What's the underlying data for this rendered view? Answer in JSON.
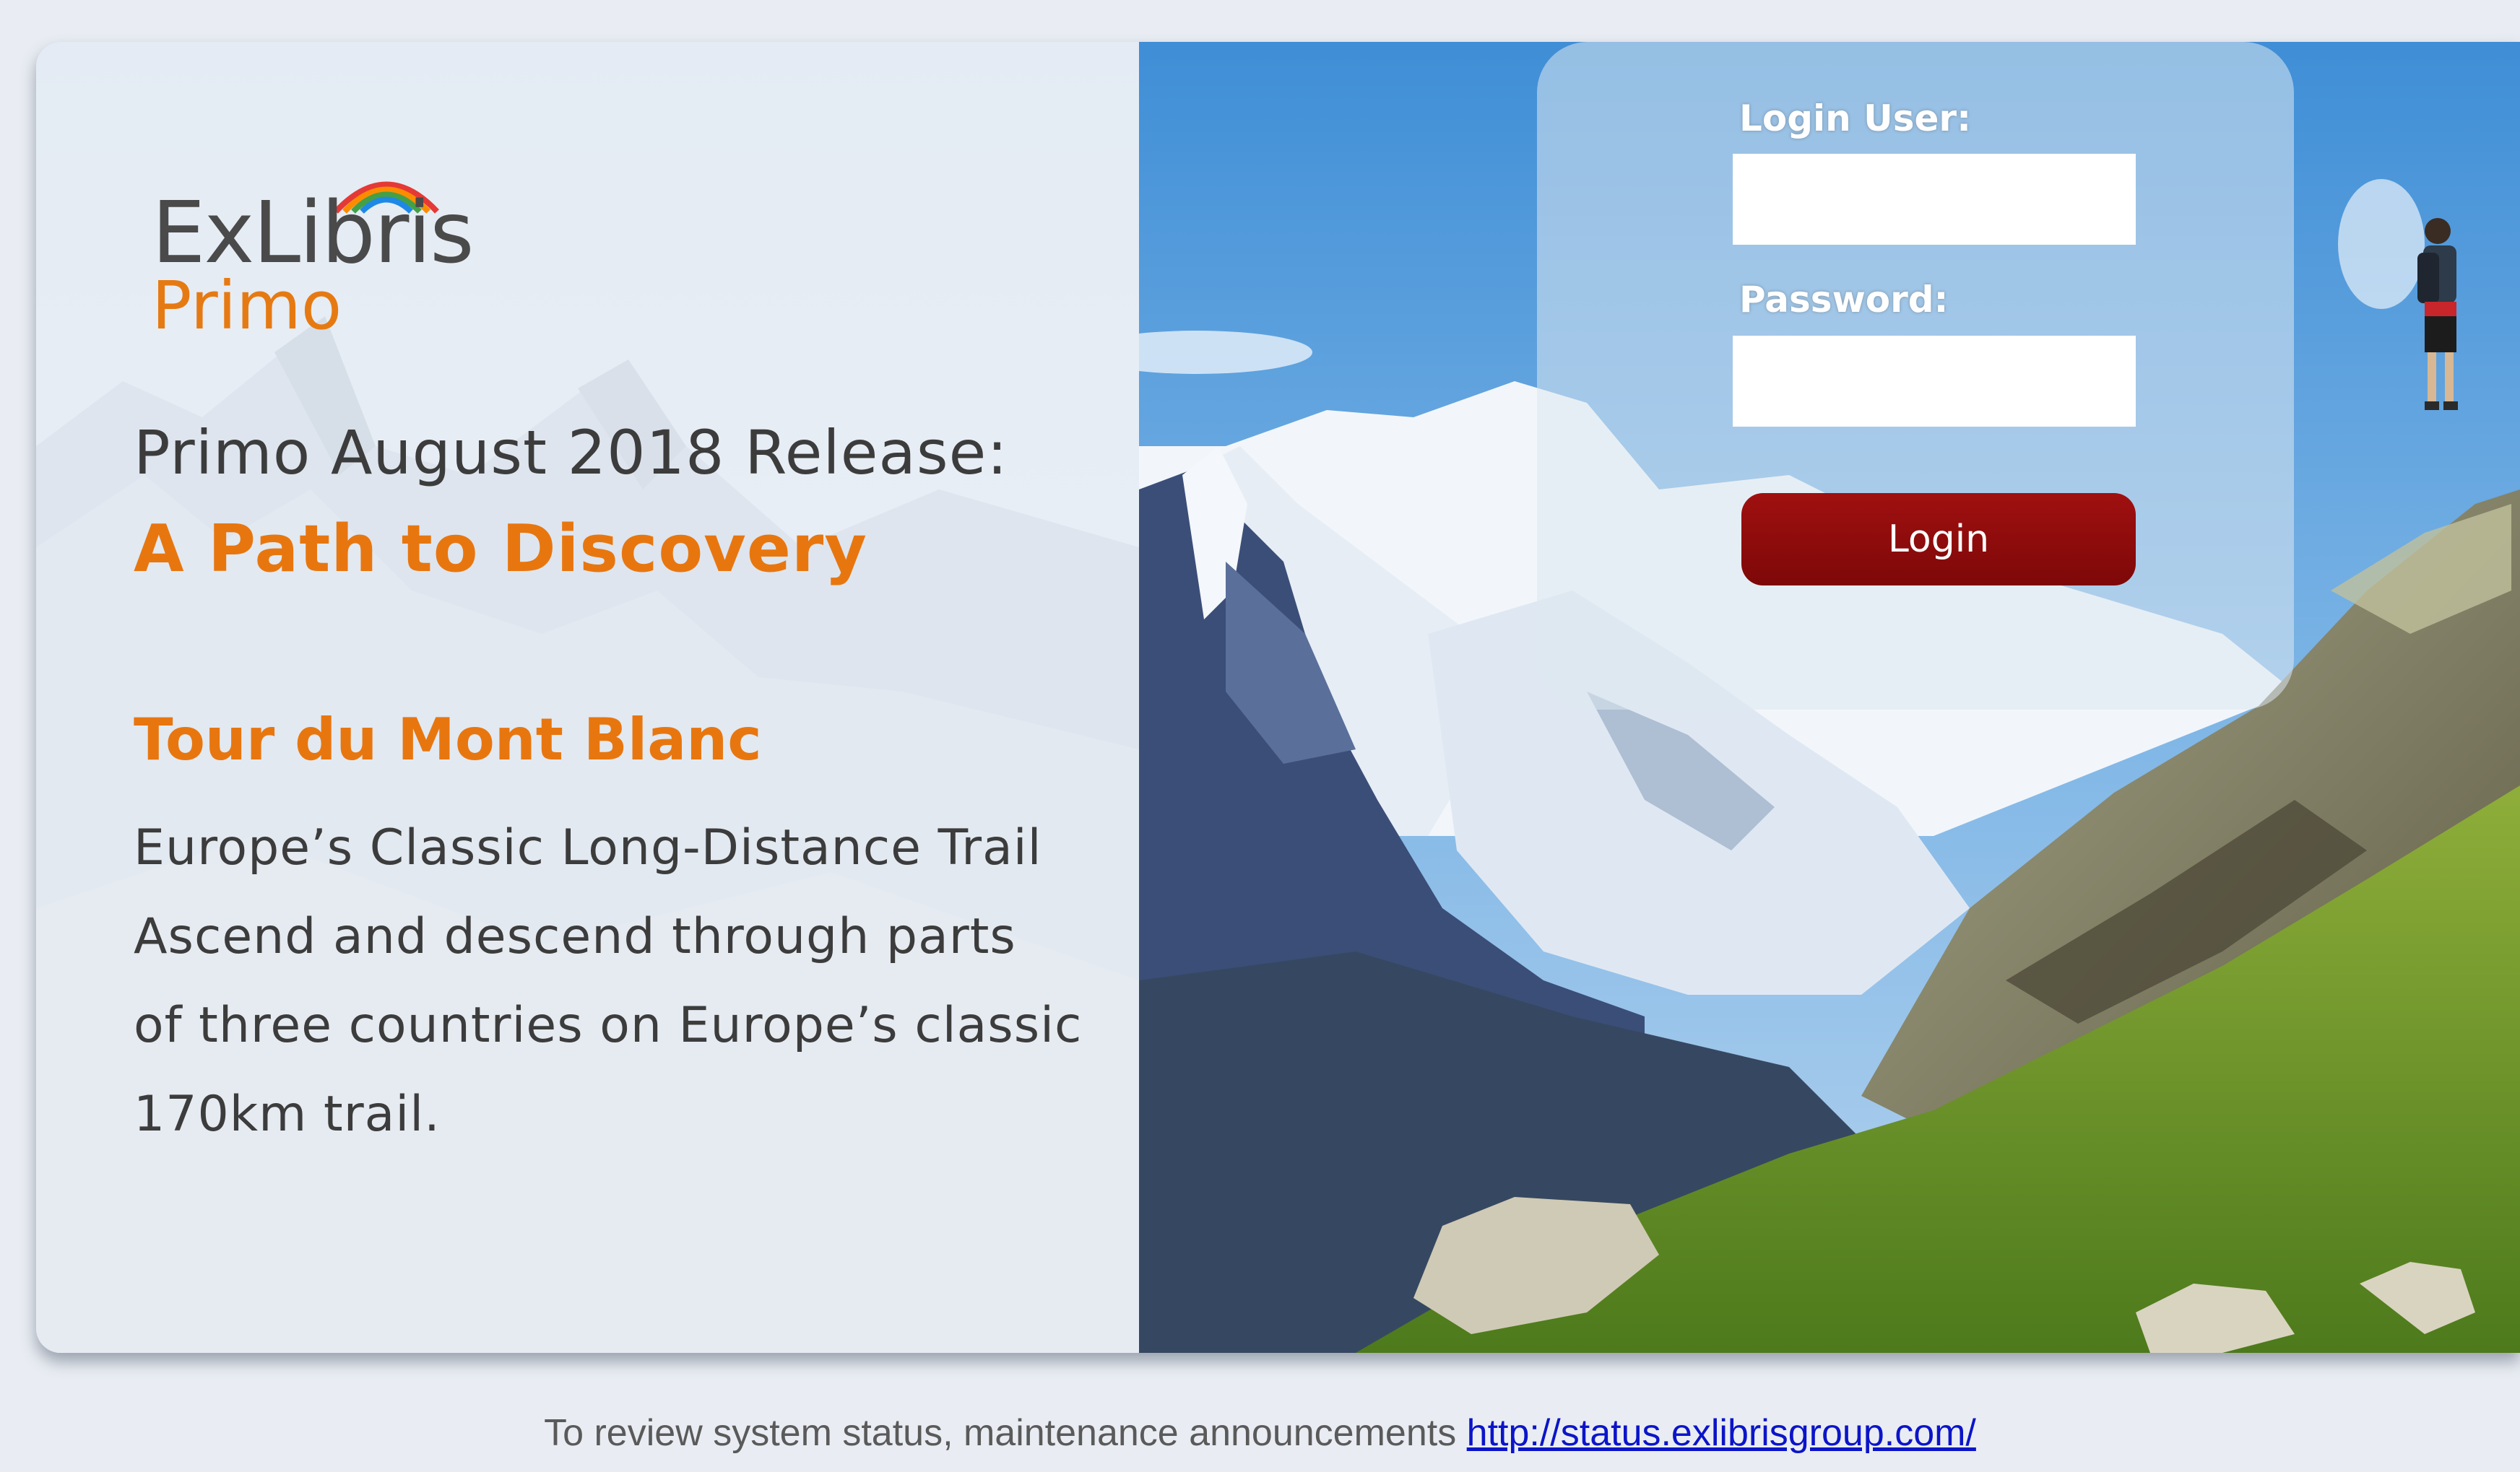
{
  "brand": {
    "logo_name": "ExLibris",
    "logo_product": "Primo"
  },
  "hero": {
    "release_line": "Primo August 2018 Release:",
    "tagline": "A Path to Discovery",
    "trail_title": "Tour du Mont Blanc",
    "lines": [
      "Europe’s Classic Long-Distance Trail",
      "Ascend and descend through parts",
      "of three countries on Europe’s classic",
      "170km trail."
    ]
  },
  "login": {
    "user_label": "Login User:",
    "user_value": "",
    "password_label": "Password:",
    "password_value": "",
    "button_label": "Login"
  },
  "footer": {
    "text": "To review system status, maintenance announcements",
    "link_text": "http://status.exlibrisgroup.com/"
  },
  "colors": {
    "accent_orange": "#e8760f",
    "login_button": "#8b0a0a",
    "link_blue": "#0b14c8",
    "page_bg": "#e9edf3"
  }
}
